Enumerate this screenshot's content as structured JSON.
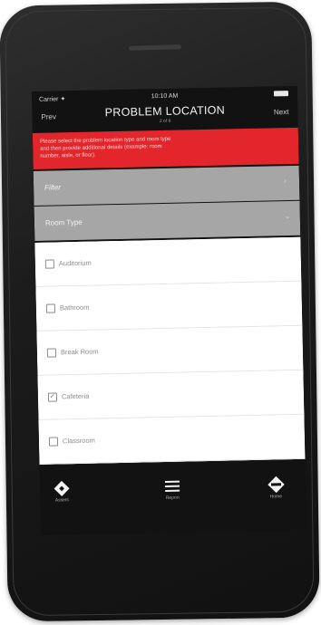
{
  "status": {
    "carrier": "Carrier ✦",
    "time": "10:10 AM"
  },
  "nav": {
    "prev": "Prev",
    "title": "PROBLEM LOCATION",
    "subtitle": "2 of 8",
    "next": "Next"
  },
  "alert": {
    "line1": "Please select the problem location type and room type",
    "line2": "and then provide additional details (example: room",
    "line3": "number, aisle, or floor)."
  },
  "sections": {
    "filter": "Filter",
    "room_type": "Room Type"
  },
  "room_types": [
    {
      "label": "Auditorium",
      "checked": false
    },
    {
      "label": "Bathroom",
      "checked": false
    },
    {
      "label": "Break Room",
      "checked": false
    },
    {
      "label": "Cafeteria",
      "checked": true
    },
    {
      "label": "Classroom",
      "checked": false
    }
  ],
  "tabs": [
    {
      "label": "Assets",
      "icon": "diamond-icon"
    },
    {
      "label": "Report",
      "icon": "menu-icon"
    },
    {
      "label": "Home",
      "icon": "diamond-sign-icon"
    }
  ],
  "colors": {
    "alert_red": "#e3262b",
    "section_gray": "#a6a6a6",
    "screen_dark": "#121212"
  }
}
